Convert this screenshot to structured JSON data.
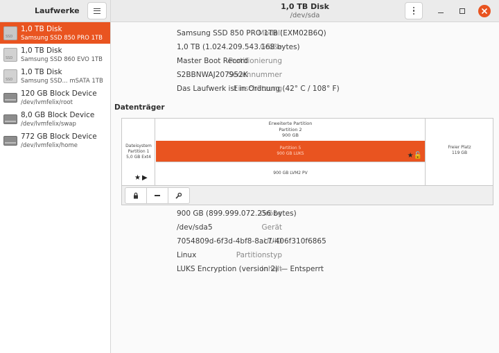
{
  "header": {
    "app_title": "Laufwerke",
    "title": "1,0 TB Disk",
    "subtitle": "/dev/sda"
  },
  "sidebar": {
    "items": [
      {
        "name": "1,0 TB Disk",
        "sub": "Samsung SSD 850 PRO 1TB",
        "icon": "ssd-icon",
        "selected": true
      },
      {
        "name": "1,0 TB Disk",
        "sub": "Samsung SSD 860 EVO 1TB",
        "icon": "ssd-icon"
      },
      {
        "name": "1,0 TB Disk",
        "sub": "Samsung SSD... mSATA 1TB",
        "icon": "ssd-icon"
      },
      {
        "name": "120 GB Block Device",
        "sub": "/dev/lvmfelix/root",
        "icon": "block-device-icon"
      },
      {
        "name": "8,0 GB Block Device",
        "sub": "/dev/lvmfelix/swap",
        "icon": "block-device-icon"
      },
      {
        "name": "772 GB Block Device",
        "sub": "/dev/lvmfelix/home",
        "icon": "block-device-icon"
      }
    ]
  },
  "drive": {
    "model_label": "Modell",
    "model": "Samsung SSD 850 PRO 1TB (EXM02B6Q)",
    "size_label": "Größe",
    "size": "1,0 TB (1.024.209.543.168 bytes)",
    "partitioning_label": "Partitionierung",
    "partitioning": "Master Boot Record",
    "serial_label": "Seriennummer",
    "serial": "S2BBNWAJ207952K",
    "assessment_label": "Einschätzung",
    "assessment": "Das Laufwerk ist in Ordnung (42° C / 108° F)"
  },
  "volumes": {
    "section_title": "Datenträger",
    "fs": {
      "line1": "Dateisystem",
      "line2": "Partition 1",
      "line3": "5,0 GB Ext4"
    },
    "extended": {
      "line1": "Erweiterte Partition",
      "line2": "Partition 2",
      "line3": "900 GB"
    },
    "p5": {
      "line1": "Partition 5",
      "line2": "900 GB LUKS"
    },
    "lvm": {
      "line1": "900 GB LVM2 PV"
    },
    "free": {
      "line1": "Freier Platz",
      "line2": "119 GB"
    }
  },
  "volume": {
    "size_label": "Größe",
    "size": "900 GB (899.999.072.256 bytes)",
    "device_label": "Gerät",
    "device": "/dev/sda5",
    "uuid_label": "UUID",
    "uuid": "7054809d-6f3d-4bf8-8ac7-406f310f6865",
    "parttype_label": "Partitionstyp",
    "parttype": "Linux",
    "contents_label": "Inhalt",
    "contents": "LUKS Encryption (version 2) — Entsperrt"
  },
  "colors": {
    "accent": "#e95420"
  }
}
